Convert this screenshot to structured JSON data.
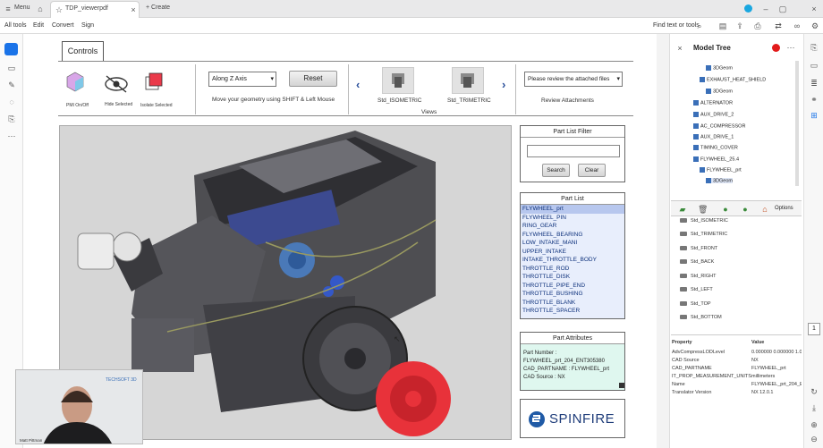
{
  "browser": {
    "menu": "Menu",
    "tab_title": "TDP_viewerpdf",
    "create": "Create"
  },
  "toolbar": {
    "all_tools": "All tools",
    "edit": "Edit",
    "convert": "Convert",
    "sign": "Sign",
    "find": "Find text or tools"
  },
  "controls": {
    "tab": "Controls",
    "pmi_label": "PMI On/Off",
    "hide_label": "Hide Selected",
    "isolate_label": "Isolate Selected",
    "axis_select": "Along Z Axis",
    "reset": "Reset",
    "move_hint": "Move your geometry using SHIFT & Left Mouse",
    "view1": "Std_ISOMETRIC",
    "view2": "Std_TRIMETRIC",
    "views_label": "Views",
    "attach_select": "Please review the attached files",
    "attach_label": "Review Attachments"
  },
  "filter": {
    "title": "Part List Filter",
    "search": "Search",
    "clear": "Clear"
  },
  "partlist": {
    "title": "Part List",
    "items": [
      "FLYWHEEL_prt",
      "FLYWHEEL_PIN",
      "RING_GEAR",
      "FLYWHEEL_BEARING",
      "LOW_INTAKE_MANI",
      "UPPER_INTAKE",
      "INTAKE_THROTTLE_BODY",
      "THROTTLE_ROD",
      "THROTTLE_DISK",
      "THROTTLE_PIPE_END",
      "THROTTLE_BUSHING",
      "THROTTLE_BLANK",
      "THROTTLE_SPACER"
    ]
  },
  "attributes": {
    "title": "Part Attributes",
    "line1": "Part Number :",
    "line2": "FLYWHEEL_prt_204_ENT305380",
    "line3": "CAD_PARTNAME :  FLYWHEEL_prt",
    "line4": "CAD Source  :  NX"
  },
  "logo": "SPINFIRE",
  "model_tree": {
    "title": "Model Tree",
    "items": [
      "3DGeom",
      "EXHAUST_HEAT_SHIELD",
      "3DGeom",
      "ALTERNATOR",
      "AUX_DRIVE_2",
      "AC_COMPRESSOR",
      "AUX_DRIVE_1",
      "TIMING_COVER",
      "FLYWHEEL_25.4",
      "FLYWHEEL_prt",
      "3DGeom"
    ]
  },
  "views_panel": {
    "options": "Options",
    "items": [
      "Std_ISOMETRIC",
      "Std_TRIMETRIC",
      "Std_FRONT",
      "Std_BACK",
      "Std_RIGHT",
      "Std_LEFT",
      "Std_TOP",
      "Std_BOTTOM"
    ]
  },
  "properties": {
    "h1": "Property",
    "h2": "Value",
    "rows": [
      [
        "AdvCompressLODLevel",
        "0.000000 0.000000 1.000"
      ],
      [
        "CAD Source",
        "NX"
      ],
      [
        "CAD_PARTNAME",
        "FLYWHEEL_prt"
      ],
      [
        "IT_PROP_MEASUREMENT_UNITS",
        "millimeters"
      ],
      [
        "Name",
        "FLYWHEEL_prt_204_EN"
      ],
      [
        "Translator Version",
        "NX 12.0.1"
      ]
    ]
  },
  "page_number": "1",
  "webcam": {
    "brand": "TECHSOFT 3D",
    "name": "Matt Pittman"
  },
  "colors": {
    "accent": "#3a6fb8",
    "partlist_bg": "#e8eefc",
    "attr_bg": "#dff7ef",
    "flywheel_red": "#e8323a"
  }
}
